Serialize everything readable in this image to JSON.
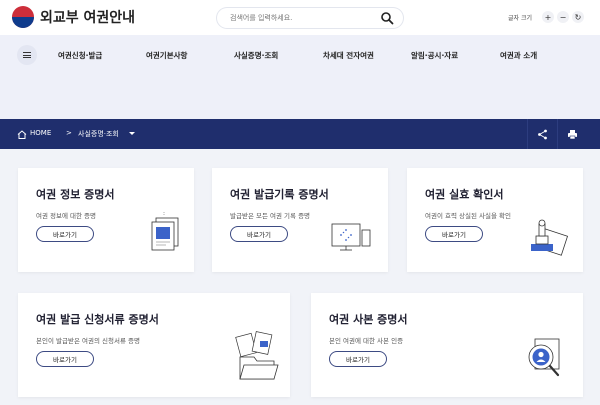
{
  "header": {
    "logo_text": "외교부 여권안내",
    "search_placeholder": "검색어를 입력하세요.",
    "font_size_label": "글자 크기",
    "font_buttons": [
      "+",
      "−",
      "↻"
    ]
  },
  "nav": {
    "items": [
      "여권신청·발급",
      "여권기본사항",
      "사실증명·조회",
      "차세대 전자여권",
      "알림·공시·자료",
      "여권과 소개"
    ]
  },
  "breadcrumb": {
    "home": "HOME",
    "separator": ">",
    "current": "사실증명·조회"
  },
  "cards": [
    {
      "title": "여권 정보 증명서",
      "desc": "여권 정보에 대한 증명",
      "button": "바로가기"
    },
    {
      "title": "여권 발급기록 증명서",
      "desc": "발급받은 모든 여권 기록 증명",
      "button": "바로가기"
    },
    {
      "title": "여권 실효 확인서",
      "desc": "여권이 효력 상실된 사실을 확인",
      "button": "바로가기"
    },
    {
      "title": "여권 발급 신청서류 증명서",
      "desc": "본인이 발급받은 여권의 신청서류 증명",
      "button": "바로가기"
    },
    {
      "title": "여권 사본 증명서",
      "desc": "본인 여권에 대한 사본 인증",
      "button": "바로가기"
    }
  ],
  "colors": {
    "navy": "#1f2e6d",
    "nav_bg": "#eef0f9",
    "page_bg": "#f1f3f8"
  }
}
